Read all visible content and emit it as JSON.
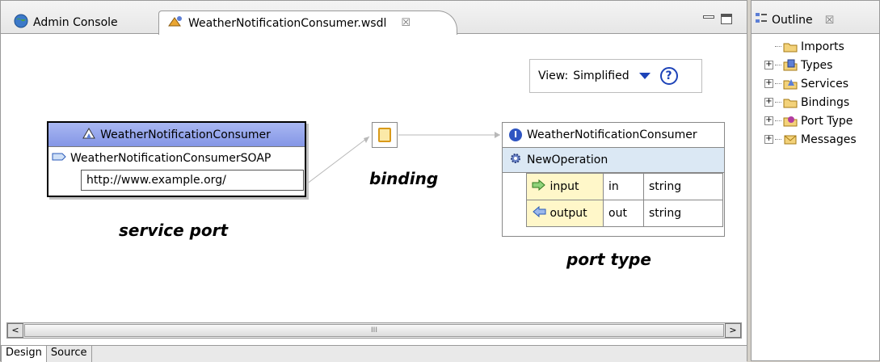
{
  "editor": {
    "tabs": [
      {
        "label": "Admin Console"
      },
      {
        "label": "WeatherNotificationConsumer.wsdl",
        "close": "☒"
      }
    ],
    "view": {
      "label": "View:",
      "value": "Simplified",
      "help": "?"
    },
    "service": {
      "name": "WeatherNotificationConsumer",
      "port_name": "WeatherNotificationConsumerSOAP",
      "address": "http://www.example.org/"
    },
    "port_type": {
      "name": "WeatherNotificationConsumer",
      "operation": "NewOperation",
      "rows": [
        {
          "name": "input",
          "direction": "in",
          "type": "string"
        },
        {
          "name": "output",
          "direction": "out",
          "type": "string"
        }
      ]
    },
    "captions": {
      "service_port": "service port",
      "binding": "binding",
      "port_type": "port type"
    },
    "scrollbar": {
      "left": "<",
      "right": ">",
      "grip": "III"
    },
    "bottom_tabs": [
      "Design",
      "Source"
    ]
  },
  "outline": {
    "title": "Outline",
    "close": "☒",
    "items": [
      {
        "label": "Imports",
        "expandable": false
      },
      {
        "label": "Types",
        "expandable": true
      },
      {
        "label": "Services",
        "expandable": true
      },
      {
        "label": "Bindings",
        "expandable": true
      },
      {
        "label": "Port Type",
        "expandable": true
      },
      {
        "label": "Messages",
        "expandable": true
      }
    ]
  },
  "colors": {
    "service_header": "#8496e6",
    "operation_row": "#dbe8f4",
    "message_cell": "#fff7c9",
    "accent_blue": "#1d43b8"
  }
}
